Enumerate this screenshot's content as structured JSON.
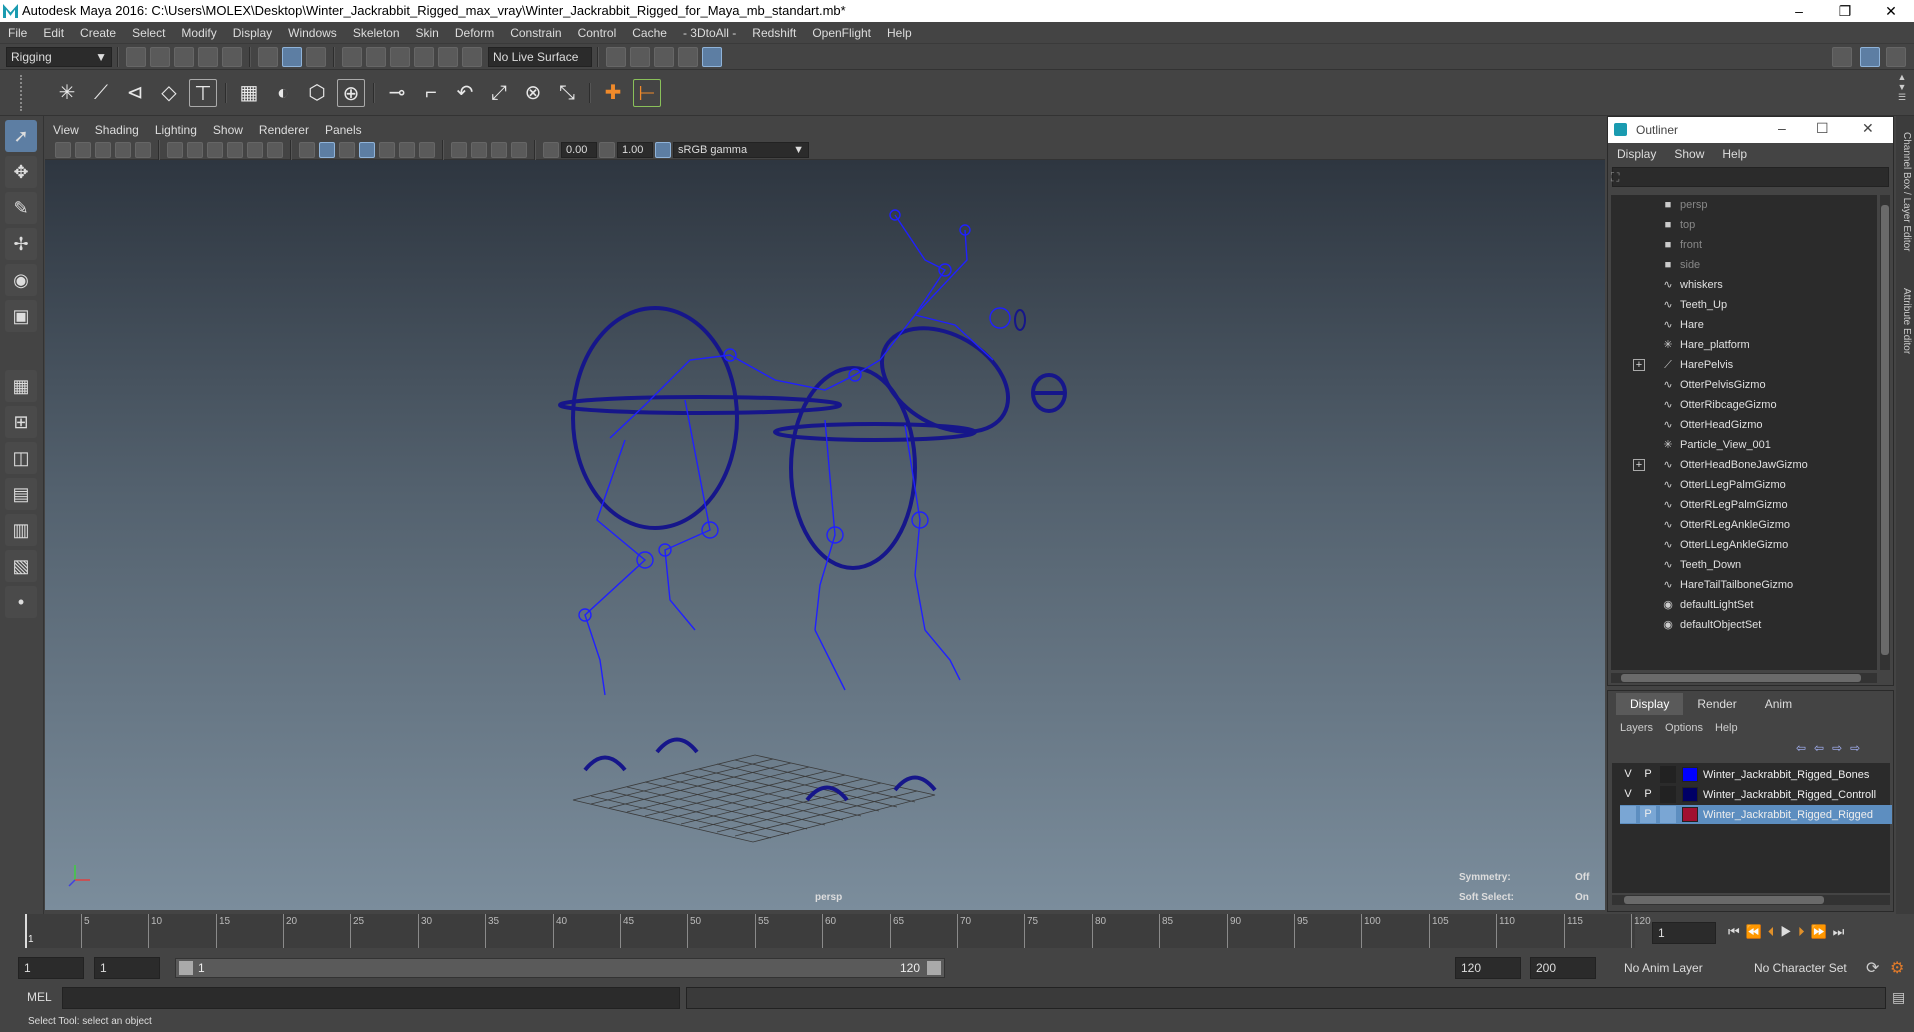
{
  "app": {
    "title": "Autodesk Maya 2016: C:\\Users\\MOLEX\\Desktop\\Winter_Jackrabbit_Rigged_max_vray\\Winter_Jackrabbit_Rigged_for_Maya_mb_standart.mb*",
    "minimize": "–",
    "maximize": "❐",
    "close": "✕"
  },
  "menubar": [
    "File",
    "Edit",
    "Create",
    "Select",
    "Modify",
    "Display",
    "Windows",
    "Skeleton",
    "Skin",
    "Deform",
    "Constrain",
    "Control",
    "Cache",
    "- 3DtoAll -",
    "Redshift",
    "OpenFlight",
    "Help"
  ],
  "statusline": {
    "mode": "Rigging",
    "live_surface": "No Live Surface"
  },
  "viewport": {
    "menu": [
      "View",
      "Shading",
      "Lighting",
      "Show",
      "Renderer",
      "Panels"
    ],
    "exposure": "0.00",
    "gamma": "1.00",
    "colorspace": "sRGB gamma",
    "camera_label": "persp",
    "hud": {
      "symmetry_label": "Symmetry:",
      "symmetry_value": "Off",
      "soft_select_label": "Soft Select:",
      "soft_select_value": "On"
    }
  },
  "outliner": {
    "title": "Outliner",
    "menu": [
      "Display",
      "Show",
      "Help"
    ],
    "items": [
      {
        "label": "persp",
        "icon": "camera-icon",
        "dim": true,
        "expand": false
      },
      {
        "label": "top",
        "icon": "camera-icon",
        "dim": true,
        "expand": false
      },
      {
        "label": "front",
        "icon": "camera-icon",
        "dim": true,
        "expand": false
      },
      {
        "label": "side",
        "icon": "camera-icon",
        "dim": true,
        "expand": false
      },
      {
        "label": "whiskers",
        "icon": "curve-icon",
        "dim": false,
        "expand": false
      },
      {
        "label": "Teeth_Up",
        "icon": "curve-icon",
        "dim": false,
        "expand": false
      },
      {
        "label": "Hare",
        "icon": "curve-icon",
        "dim": false,
        "expand": false
      },
      {
        "label": "Hare_platform",
        "icon": "locator-icon",
        "dim": false,
        "expand": false
      },
      {
        "label": "HarePelvis",
        "icon": "joint-icon",
        "dim": false,
        "expand": true
      },
      {
        "label": "OtterPelvisGizmo",
        "icon": "curve-icon",
        "dim": false,
        "expand": false
      },
      {
        "label": "OtterRibcageGizmo",
        "icon": "curve-icon",
        "dim": false,
        "expand": false
      },
      {
        "label": "OtterHeadGizmo",
        "icon": "curve-icon",
        "dim": false,
        "expand": false
      },
      {
        "label": "Particle_View_001",
        "icon": "locator-icon",
        "dim": false,
        "expand": false
      },
      {
        "label": "OtterHeadBoneJawGizmo",
        "icon": "curve-icon",
        "dim": false,
        "expand": true
      },
      {
        "label": "OtterLLegPalmGizmo",
        "icon": "curve-icon",
        "dim": false,
        "expand": false
      },
      {
        "label": "OtterRLegPalmGizmo",
        "icon": "curve-icon",
        "dim": false,
        "expand": false
      },
      {
        "label": "OtterRLegAnkleGizmo",
        "icon": "curve-icon",
        "dim": false,
        "expand": false
      },
      {
        "label": "OtterLLegAnkleGizmo",
        "icon": "curve-icon",
        "dim": false,
        "expand": false
      },
      {
        "label": "Teeth_Down",
        "icon": "curve-icon",
        "dim": false,
        "expand": false
      },
      {
        "label": "HareTailTailboneGizmo",
        "icon": "curve-icon",
        "dim": false,
        "expand": false
      },
      {
        "label": "defaultLightSet",
        "icon": "set-icon",
        "dim": false,
        "expand": false
      },
      {
        "label": "defaultObjectSet",
        "icon": "set-icon",
        "dim": false,
        "expand": false
      }
    ]
  },
  "right_tabs": [
    "Channel Box / Layer Editor",
    "Attribute Editor"
  ],
  "layer_editor": {
    "tabs": [
      "Display",
      "Render",
      "Anim"
    ],
    "menu": [
      "Layers",
      "Options",
      "Help"
    ],
    "layers": [
      {
        "v": "V",
        "p": "P",
        "name": "Winter_Jackrabbit_Rigged_Bones",
        "color": "#0000ff",
        "selected": false
      },
      {
        "v": "V",
        "p": "P",
        "name": "Winter_Jackrabbit_Rigged_Controll",
        "color": "#000066",
        "selected": false
      },
      {
        "v": "",
        "p": "P",
        "name": "Winter_Jackrabbit_Rigged_Rigged",
        "color": "#a01030",
        "selected": true
      }
    ]
  },
  "timeline": {
    "start_label": "1",
    "tick_labels": [
      "5",
      "10",
      "15",
      "20",
      "25",
      "30",
      "35",
      "40",
      "45",
      "50",
      "55",
      "60",
      "65",
      "70",
      "75",
      "80",
      "85",
      "90",
      "95",
      "100",
      "105",
      "110",
      "115",
      "120"
    ],
    "current_frame": "1"
  },
  "range": {
    "start": "1",
    "playback_start": "1",
    "slider_start": "1",
    "slider_end": "120",
    "playback_end": "120",
    "end": "200",
    "anim_layer": "No Anim Layer",
    "character_set": "No Character Set"
  },
  "command": {
    "mode": "MEL"
  },
  "help_line": "Select Tool: select an object"
}
